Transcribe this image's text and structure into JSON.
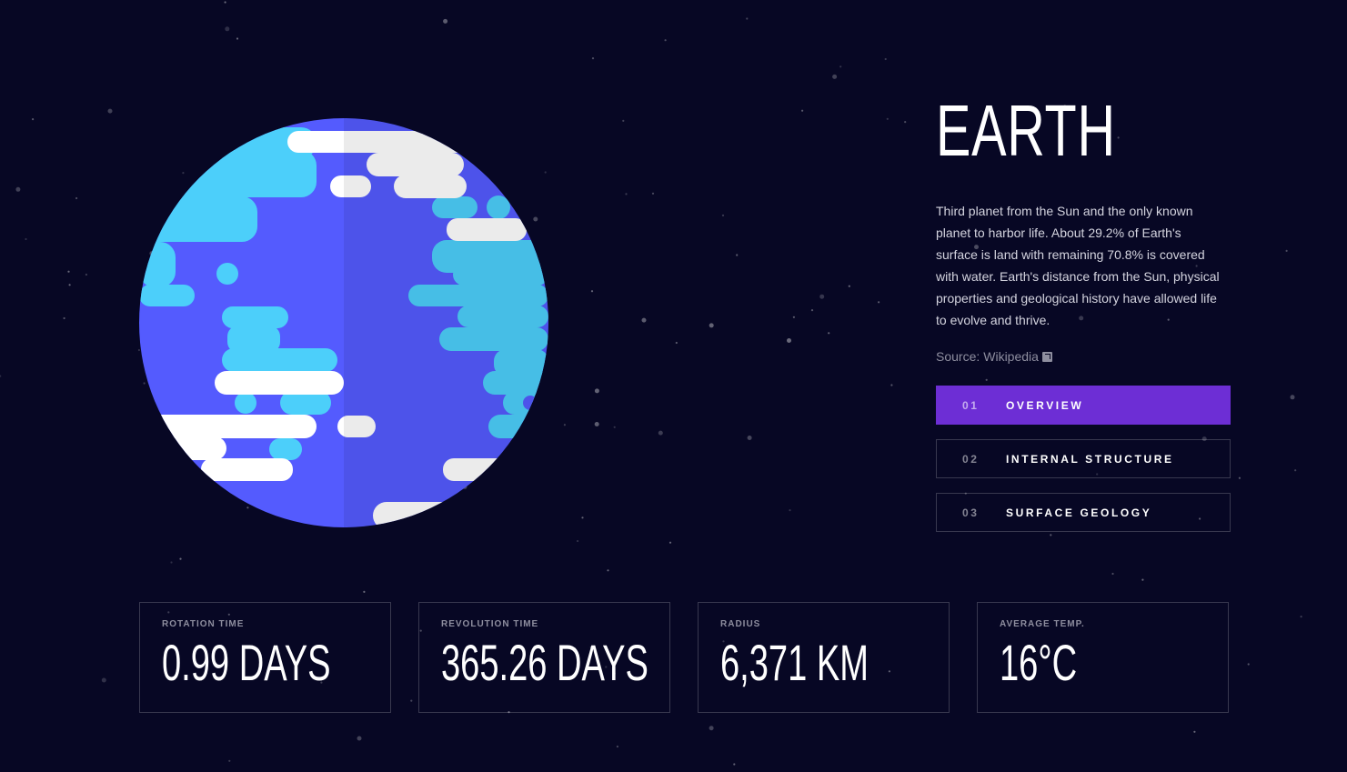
{
  "planet": {
    "name": "EARTH",
    "description": "Third planet from the Sun and the only known planet to harbor life. About 29.2% of Earth's surface is land with remaining 70.8% is covered with water. Earth's distance from the Sun, physical properties and geological history have allowed life to evolve and thrive.",
    "source_prefix": "Source: ",
    "source_link": "Wikipedia",
    "source_icon": "external-link-icon",
    "image_icon": "earth-illustration"
  },
  "tabs": [
    {
      "num": "01",
      "label": "OVERVIEW",
      "active": true
    },
    {
      "num": "02",
      "label": "INTERNAL STRUCTURE",
      "active": false
    },
    {
      "num": "03",
      "label": "SURFACE GEOLOGY",
      "active": false
    }
  ],
  "stats": [
    {
      "label": "ROTATION TIME",
      "value": "0.99 DAYS"
    },
    {
      "label": "REVOLUTION TIME",
      "value": "365.26 DAYS"
    },
    {
      "label": "RADIUS",
      "value": "6,371 KM"
    },
    {
      "label": "AVERAGE TEMP.",
      "value": "16°C"
    }
  ],
  "colors": {
    "background": "#070724",
    "accent": "#6d2ed5",
    "ocean": "#545bfe",
    "land": "#4ccffa",
    "cloud": "#ffffff"
  }
}
